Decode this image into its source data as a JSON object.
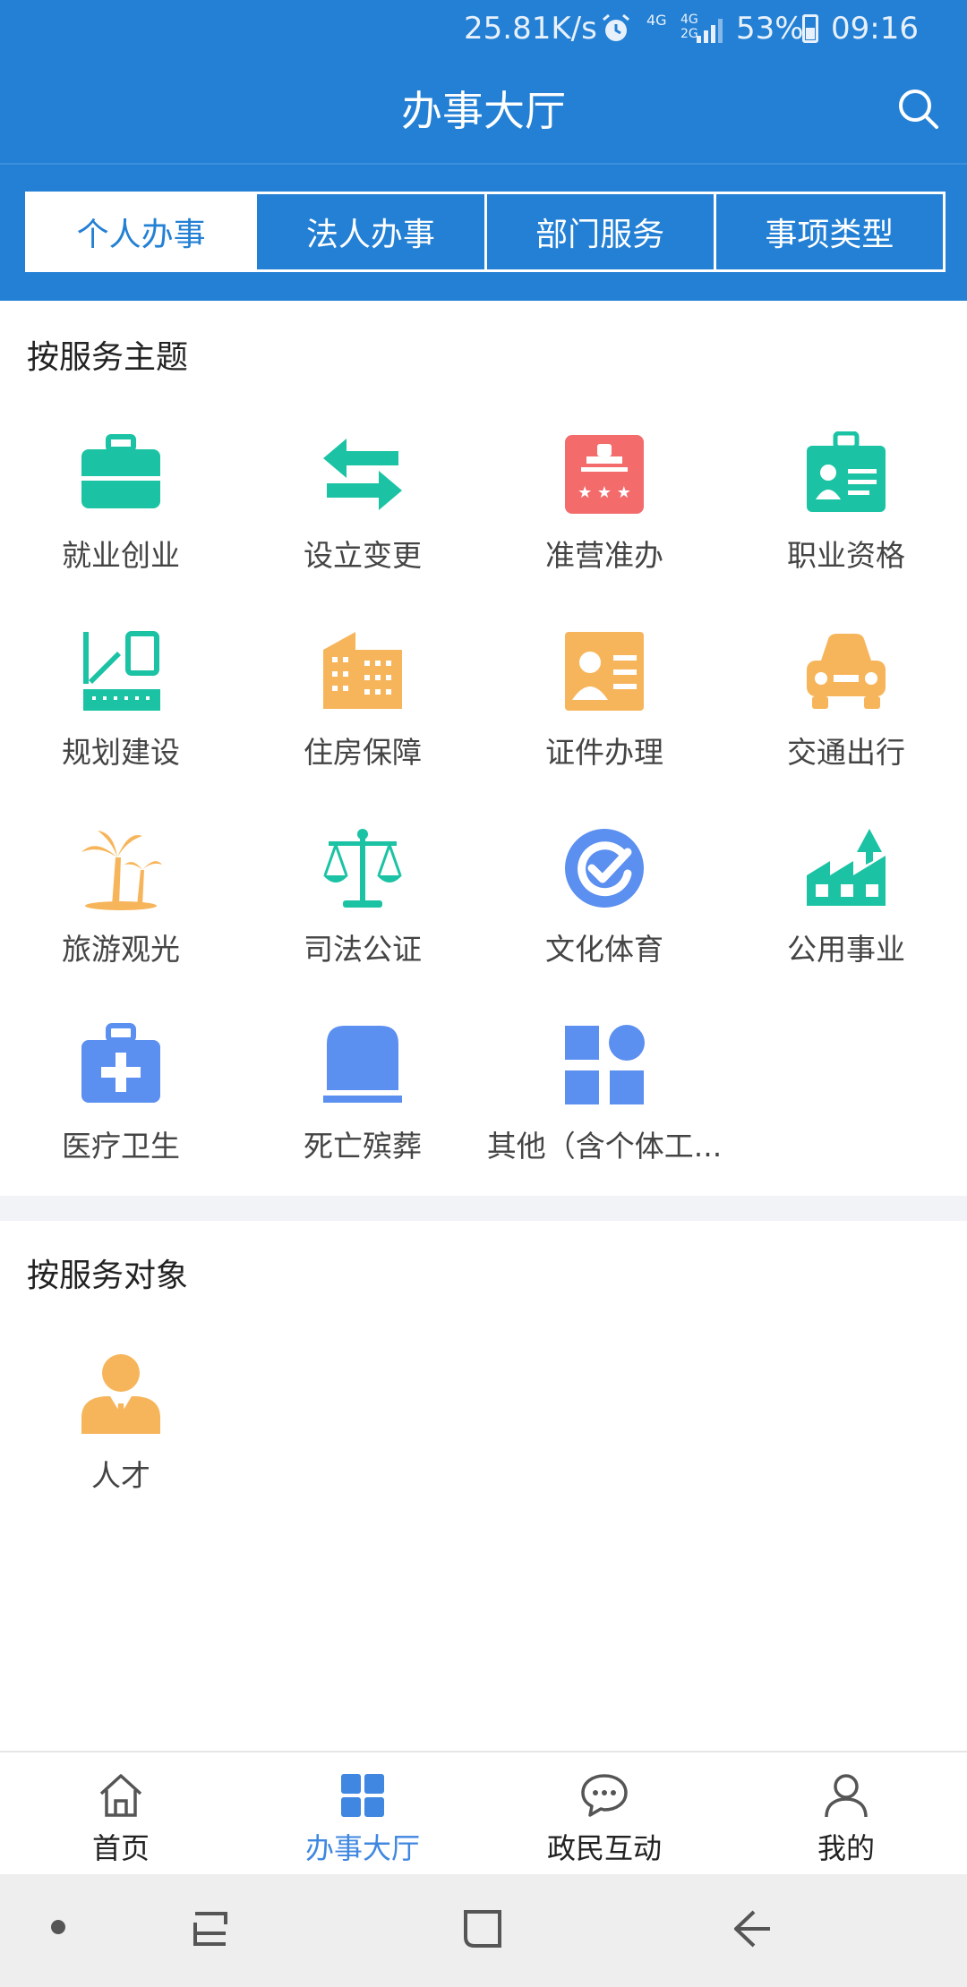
{
  "status_bar": {
    "net_speed": "25.81K/s",
    "network_4g": "4G",
    "network_2g": "4G 2G",
    "battery_percent": "53%",
    "time": "09:16",
    "alarm_icon": "alarm-clock-icon",
    "battery_icon": "battery-icon"
  },
  "header": {
    "title": "办事大厅",
    "search_icon": "search-icon"
  },
  "tabs": [
    {
      "label": "个人办事",
      "active": true
    },
    {
      "label": "法人办事",
      "active": false
    },
    {
      "label": "部门服务",
      "active": false
    },
    {
      "label": "事项类型",
      "active": false
    }
  ],
  "section_theme": {
    "title": "按服务主题",
    "items": [
      {
        "label": "就业创业",
        "icon": "briefcase-icon",
        "color": "#1bc3a4"
      },
      {
        "label": "设立变更",
        "icon": "swap-arrows-icon",
        "color": "#1bc3a4"
      },
      {
        "label": "准营准办",
        "icon": "stamp-icon",
        "color": "#f36b6b"
      },
      {
        "label": "职业资格",
        "icon": "id-badge-icon",
        "color": "#1bc3a4"
      },
      {
        "label": "规划建设",
        "icon": "blueprint-icon",
        "color": "#1bc3a4"
      },
      {
        "label": "住房保障",
        "icon": "building-icon",
        "color": "#f7b55b"
      },
      {
        "label": "证件办理",
        "icon": "id-card-icon",
        "color": "#f7b55b"
      },
      {
        "label": "交通出行",
        "icon": "car-icon",
        "color": "#f7b55b"
      },
      {
        "label": "旅游观光",
        "icon": "palm-tree-icon",
        "color": "#f7b55b"
      },
      {
        "label": "司法公证",
        "icon": "scales-icon",
        "color": "#1bc3a4"
      },
      {
        "label": "文化体育",
        "icon": "check-circle-icon",
        "color": "#5b8ff0"
      },
      {
        "label": "公用事业",
        "icon": "factory-icon",
        "color": "#1bc3a4"
      },
      {
        "label": "医疗卫生",
        "icon": "medical-kit-icon",
        "color": "#5b8ff0"
      },
      {
        "label": "死亡殡葬",
        "icon": "tombstone-icon",
        "color": "#5b8ff0"
      },
      {
        "label": "其他（含个体工...",
        "icon": "apps-grid-icon",
        "color": "#5b8ff0"
      }
    ]
  },
  "section_target": {
    "title": "按服务对象",
    "items": [
      {
        "label": "人才",
        "icon": "person-suit-icon",
        "color": "#f7b55b"
      }
    ]
  },
  "tabbar": [
    {
      "label": "首页",
      "icon": "home-icon",
      "active": false
    },
    {
      "label": "办事大厅",
      "icon": "grid-icon",
      "active": true
    },
    {
      "label": "政民互动",
      "icon": "chat-bubble-icon",
      "active": false
    },
    {
      "label": "我的",
      "icon": "user-icon",
      "active": false
    }
  ],
  "colors": {
    "primary": "#2380d4",
    "teal": "#1bc3a4",
    "orange": "#f7b55b",
    "red": "#f36b6b",
    "blue": "#5b8ff0",
    "tab_active": "#3f87e0"
  }
}
